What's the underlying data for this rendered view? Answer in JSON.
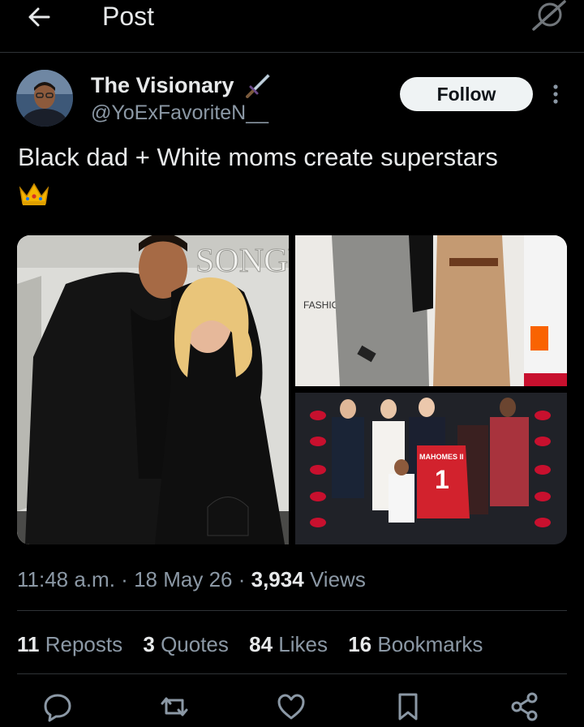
{
  "header": {
    "title": "Post",
    "back_icon": "arrow-left-icon",
    "grok_icon": "grok-icon"
  },
  "author": {
    "name": "The Visionary",
    "name_emoji": "dagger-icon",
    "handle": "@YoExFavoriteN__",
    "follow_label": "Follow"
  },
  "post": {
    "text": "Black dad + White moms create superstars",
    "emoji": "crown-icon"
  },
  "media": {
    "photo_texts": [
      "FASHIO",
      "MAHOMES II",
      "1"
    ]
  },
  "meta": {
    "time": "11:48 a.m.",
    "date": "18 May 26",
    "views_count": "3,934",
    "views_label": "Views",
    "dot": "·"
  },
  "stats": [
    {
      "count": "11",
      "label": "Reposts"
    },
    {
      "count": "3",
      "label": "Quotes"
    },
    {
      "count": "84",
      "label": "Likes"
    },
    {
      "count": "16",
      "label": "Bookmarks"
    }
  ],
  "actions": [
    "reply-icon",
    "repost-icon",
    "like-icon",
    "bookmark-icon",
    "share-icon"
  ],
  "colors": {
    "background": "#000000",
    "text": "#e7e9ea",
    "secondary": "#8b98a5",
    "divider": "#2f3336",
    "follow_bg": "#eff3f4"
  }
}
